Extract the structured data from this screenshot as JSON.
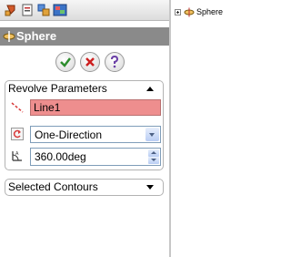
{
  "panel": {
    "title": "Sphere",
    "revolve": {
      "header": "Revolve Parameters",
      "axis_value": "Line1",
      "direction_value": "One-Direction",
      "angle_value": "360.00deg"
    },
    "contours": {
      "header": "Selected Contours"
    }
  },
  "tree": {
    "item_label": "Sphere"
  },
  "colors": {
    "title_bar": "#8a8a8a",
    "axis_field": "#ee8e8e",
    "ok": "#2d8d2d",
    "cancel": "#cc1f1f",
    "help": "#6a3fa6"
  },
  "icons": {
    "toolbar": [
      "feature-manager-icon",
      "property-manager-icon",
      "configuration-manager-icon",
      "display-manager-icon"
    ],
    "title": "revolve-feature-icon",
    "axis": "axis-line-icon",
    "direction": "reverse-direction-icon",
    "angle": "angle-icon",
    "tree": "revolve-feature-icon"
  }
}
